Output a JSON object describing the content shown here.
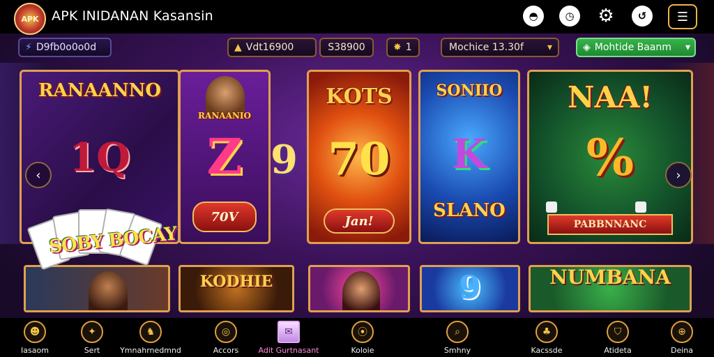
{
  "app": {
    "title": "APK INIDANAN Kasansin",
    "logo_text": "APK"
  },
  "topbar_icons": [
    "wallet-icon",
    "clock-icon",
    "gear-icon",
    "refresh-icon"
  ],
  "status": {
    "user_id": "D9fb0o0o0d",
    "coins": "Vdt16900",
    "balance": "S38900",
    "stars": "1",
    "dropdown_value": "Mochice 13.30f",
    "action_label": "Mohtide Baanm"
  },
  "cards": [
    {
      "title": "RANAANNO",
      "big": "1Q"
    },
    {
      "title": "RANAANIO",
      "big": "Z",
      "button": "70V"
    },
    {
      "title": "KOTS",
      "big": "70",
      "button": "Jan!"
    },
    {
      "title": "SONIIO",
      "big": "K",
      "subtitle": "SLANO"
    },
    {
      "title": "NAA!",
      "big": "%",
      "banner": "PABBNNANC"
    }
  ],
  "middle_number": "9",
  "fan_text": "SOBY BOCAY",
  "thumbs": [
    {
      "title": ""
    },
    {
      "title": "KODHIE"
    },
    {
      "title": ""
    },
    {
      "title": "9"
    },
    {
      "title": "NUMBANA"
    }
  ],
  "nav": [
    {
      "label": "Iasaom",
      "icon": "avatar-icon",
      "glyph": "☻"
    },
    {
      "label": "Sert",
      "icon": "star-icon",
      "glyph": "✦"
    },
    {
      "label": "Ymnahrnedmnd",
      "icon": "cat-icon",
      "glyph": "♞"
    },
    {
      "label": "Accors",
      "icon": "search-icon",
      "glyph": "◎"
    },
    {
      "label": "Adit Gurtnasant",
      "icon": "mail-icon",
      "glyph": "✉",
      "active": true
    },
    {
      "label": "Koloie",
      "icon": "pin-icon",
      "glyph": "⦿"
    },
    {
      "label": "Smhny",
      "icon": "magnifier-icon",
      "glyph": "⌕"
    },
    {
      "label": "Kacssde",
      "icon": "clover-icon",
      "glyph": "♣"
    },
    {
      "label": "Atideta",
      "icon": "shield-icon",
      "glyph": "⛉"
    },
    {
      "label": "Deina",
      "icon": "globe-icon",
      "glyph": "⊕"
    }
  ]
}
